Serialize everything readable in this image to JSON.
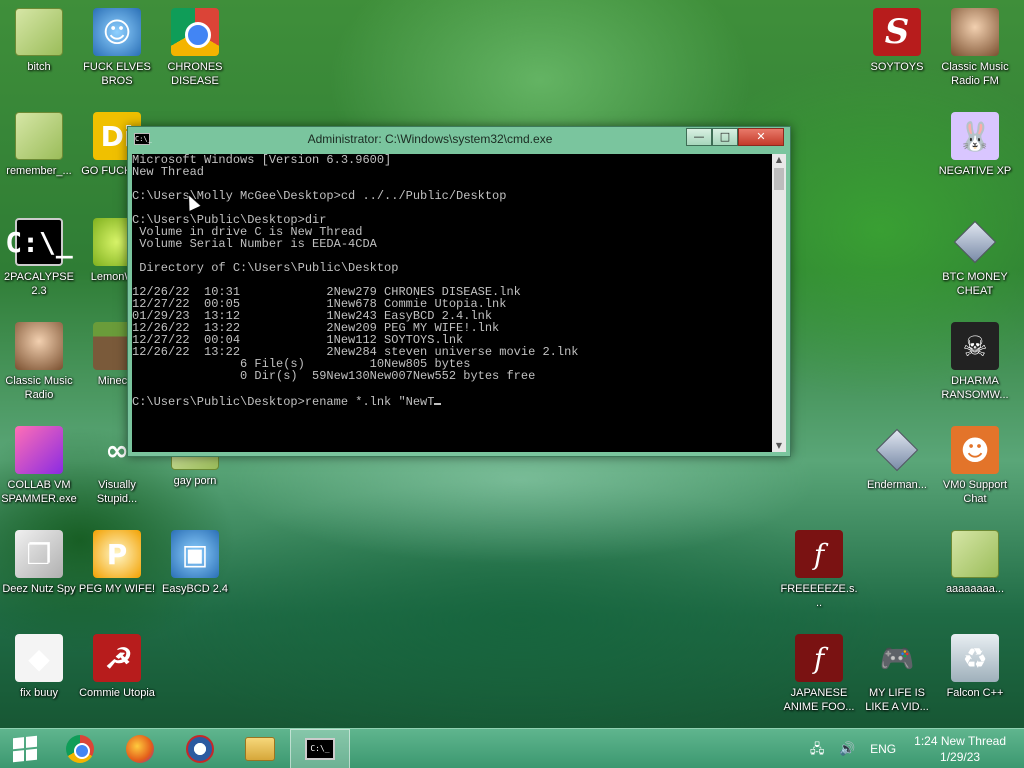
{
  "desktop": {
    "icons_left": [
      {
        "label": "bitch",
        "icon": "folder-icon",
        "x": 0,
        "y": 0
      },
      {
        "label": "FUCK ELVES BROS",
        "icon": "elf-icon"
      },
      {
        "label": "CHRONES DISEASE",
        "icon": "chrome-icon"
      },
      {
        "label": "remember_...",
        "icon": "folder-icon"
      },
      {
        "label": "GO FUCK DIE",
        "icon": "di-icon"
      },
      {
        "label": "2PACALYPSE 2.3",
        "icon": "cmd-icon"
      },
      {
        "label": "LemonW...",
        "icon": "lemon-icon"
      },
      {
        "label": "Classic Music Radio",
        "icon": "portrait-icon"
      },
      {
        "label": "Minec...",
        "icon": "minecraft-icon"
      },
      {
        "label": "COLLAB VM SPAMMER.exe",
        "icon": "spammer-icon"
      },
      {
        "label": "Visually Stupid...",
        "icon": "visual-studio-icon"
      },
      {
        "label": "gay porn",
        "icon": "folder-icon"
      },
      {
        "label": "Deez Nutz Spy",
        "icon": "windows-stack-icon"
      },
      {
        "label": "PEG MY WIFE!",
        "icon": "p-star-icon"
      },
      {
        "label": "EasyBCD 2.4",
        "icon": "easybcd-icon"
      },
      {
        "label": "fix buuy",
        "icon": "paper-icon"
      },
      {
        "label": "Commie Utopia",
        "icon": "commie-icon"
      }
    ],
    "icons_right": [
      {
        "label": "SOYTOYS",
        "icon": "s-logo-icon"
      },
      {
        "label": "Classic Music Radio FM",
        "icon": "portrait-icon"
      },
      {
        "label": "NEGATIVE XP",
        "icon": "bunny-icon"
      },
      {
        "label": "BTC MONEY CHEAT",
        "icon": "diamond-icon"
      },
      {
        "label": "DHARMA RANSOMW...",
        "icon": "skull-icon"
      },
      {
        "label": "Enderman...",
        "icon": "diamond-icon"
      },
      {
        "label": "VM0 Support Chat",
        "icon": "support-icon"
      },
      {
        "label": "FREEEEEZE.s...",
        "icon": "flash-icon"
      },
      {
        "label": "aaaaaaaa...",
        "icon": "folder-icon"
      },
      {
        "label": "JAPANESE ANIME FOO...",
        "icon": "flash-icon"
      },
      {
        "label": "MY LIFE IS LIKE A VID...",
        "icon": "gamepad-icon"
      },
      {
        "label": "Falcon C++",
        "icon": "recycle-bin-icon"
      }
    ]
  },
  "cmd": {
    "title": "Administrator: C:\\Windows\\system32\\cmd.exe",
    "app_icon_text": "C:\\_",
    "minimize": "—",
    "maximize": "□",
    "close": "✕",
    "lines": [
      "Microsoft Windows [Version 6.3.9600]",
      "New Thread",
      "",
      "C:\\Users\\Molly McGee\\Desktop>cd ../../Public/Desktop",
      "",
      "C:\\Users\\Public\\Desktop>dir",
      " Volume in drive C is New Thread",
      " Volume Serial Number is EEDA-4CDA",
      "",
      " Directory of C:\\Users\\Public\\Desktop",
      "",
      "12/26/22  10:31            2New279 CHRONES DISEASE.lnk",
      "12/27/22  00:05            1New678 Commie Utopia.lnk",
      "01/29/23  13:12            1New243 EasyBCD 2.4.lnk",
      "12/26/22  13:22            2New209 PEG MY WIFE!.lnk",
      "12/27/22  00:04            1New112 SOYTOYS.lnk",
      "12/26/22  13:22            2New284 steven universe movie 2.lnk",
      "               6 File(s)         10New805 bytes",
      "               0 Dir(s)  59New130New007New552 bytes free",
      "",
      "C:\\Users\\Public\\Desktop>rename *.lnk \"NewT"
    ]
  },
  "taskbar": {
    "items": [
      {
        "name": "chrome"
      },
      {
        "name": "firefox"
      },
      {
        "name": "obama"
      },
      {
        "name": "file-explorer"
      },
      {
        "name": "cmd",
        "text": "C:\\_"
      }
    ],
    "tray": {
      "language": "ENG",
      "time": "1:24 New Thread",
      "date": "1/29/23"
    }
  }
}
